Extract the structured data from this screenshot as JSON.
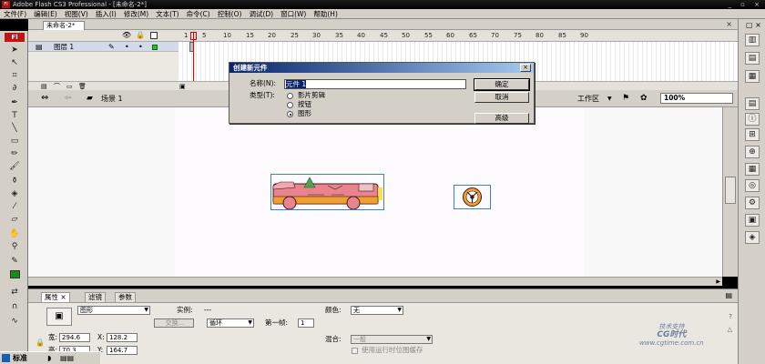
{
  "window": {
    "title": "Adobe Flash CS3 Professional - [未命名-2*]",
    "controls": "_ ▫ ×"
  },
  "menu": [
    "文件(F)",
    "编辑(E)",
    "视图(V)",
    "插入(I)",
    "修改(M)",
    "文本(T)",
    "命令(C)",
    "控制(O)",
    "调试(D)",
    "窗口(W)",
    "帮助(H)"
  ],
  "document": {
    "tab": "未命名-2*",
    "close": "×"
  },
  "tools": {
    "logo": "Fl"
  },
  "timeline": {
    "layer_name": "图层 1",
    "ticks": [
      "1",
      "5",
      "10",
      "15",
      "20",
      "25",
      "30",
      "35",
      "40",
      "45",
      "50",
      "55",
      "60",
      "65",
      "70",
      "75",
      "80",
      "85",
      "90"
    ],
    "current_frame": 1
  },
  "editbar": {
    "scene": "场景 1",
    "workspace": "工作区",
    "zoom": "100%"
  },
  "dialog": {
    "title": "创建新元件",
    "name_label": "名称(N):",
    "name_value": "元件 1",
    "type_label": "类型(T):",
    "types": [
      "影片剪辑",
      "按钮",
      "图形"
    ],
    "selected_type": "图形",
    "ok": "确定",
    "cancel": "取消",
    "advanced": "高级"
  },
  "properties": {
    "tabs": [
      "属性 ×",
      "滤镜",
      "参数"
    ],
    "symbol_type": "图形",
    "instance_label": "实例:",
    "instance_value": "---",
    "swap_label": "交换...",
    "loop_value": "循环",
    "first_frame_label": "第一帧:",
    "first_frame_value": "1",
    "color_label": "颜色:",
    "color_value": "无",
    "width_label": "宽:",
    "width_value": "294.6",
    "x_label": "X:",
    "x_value": "128.2",
    "height_label": "高:",
    "height_value": "70.3",
    "y_label": "Y:",
    "y_value": "164.7",
    "blend_label": "混合:",
    "blend_value": "一般",
    "cache_label": "使用运行时位图缓存"
  },
  "watermark": {
    "line1": "技术支持",
    "line2": "CG时代",
    "line3": "www.cgtime.com.cn"
  },
  "taskbar": {
    "label": "标准"
  },
  "colors": {
    "accent": "#0a246a",
    "logo_red": "#c21414",
    "playhead": "#e00000",
    "car_body": "#e9848e",
    "selection": "#3f7fd0"
  }
}
